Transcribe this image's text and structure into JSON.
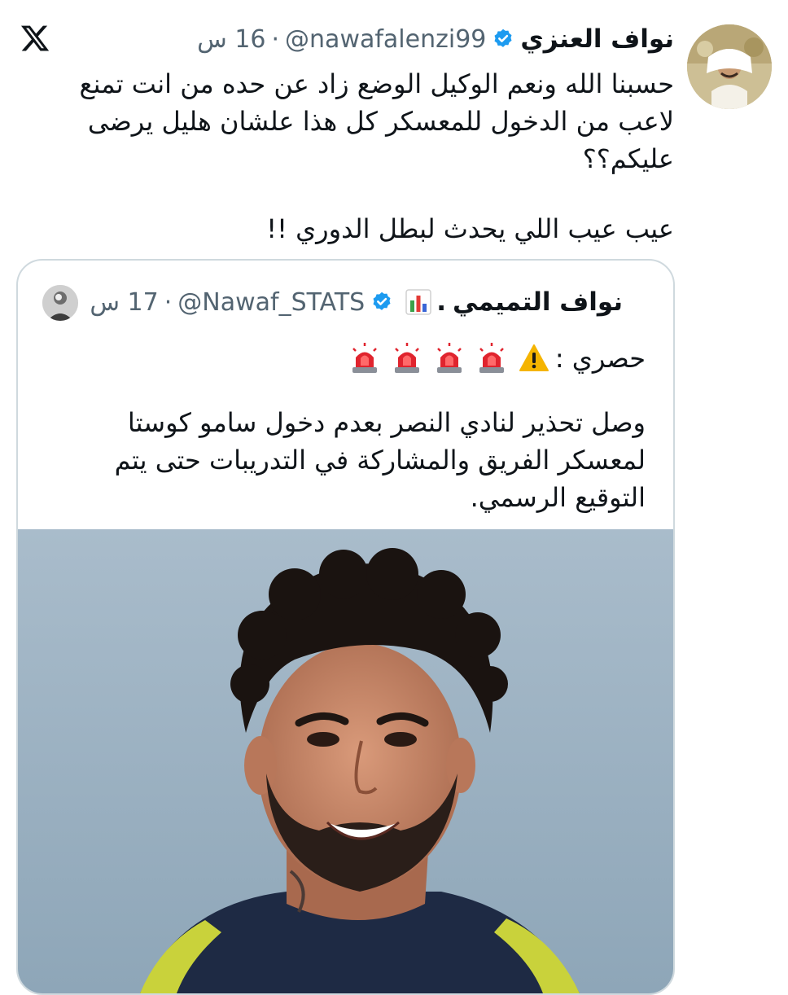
{
  "post": {
    "display_name": "نواف العنزي",
    "handle": "@nawafalenzi99",
    "time_ago": "16 س",
    "separator": "·",
    "body_line_1": "حسبنا الله ونعم الوكيل الوضع زاد عن حده من انت تمنع لاعب من الدخول للمعسكر كل هذا علشان هليل يرضى عليكم؟؟",
    "body_line_2": "عيب عيب اللي يحدث لبطل الدوري !!"
  },
  "quoted": {
    "display_name": "نواف التميمي",
    "name_suffix": ".",
    "handle": "@Nawaf_STATS",
    "time_ago": "17 س",
    "separator": "·",
    "label": "حصري :",
    "body": "وصل تحذير لنادي النصر بعدم دخول سامو كوستا لمعسكر الفريق والمشاركة في التدريبات حتى يتم التوقيع الرسمي."
  },
  "colors": {
    "verified_blue": "#1d9bf0",
    "secondary_text": "#536471",
    "border": "#cfd9de",
    "siren_red": "#e0242e",
    "warning_yellow": "#f5b400"
  },
  "icons": {
    "logo": "x-logo-icon",
    "verified": "verified-badge-icon",
    "chart": "bar-chart-emoji-icon",
    "siren": "police-siren-emoji-icon",
    "warning": "warning-emoji-icon"
  }
}
